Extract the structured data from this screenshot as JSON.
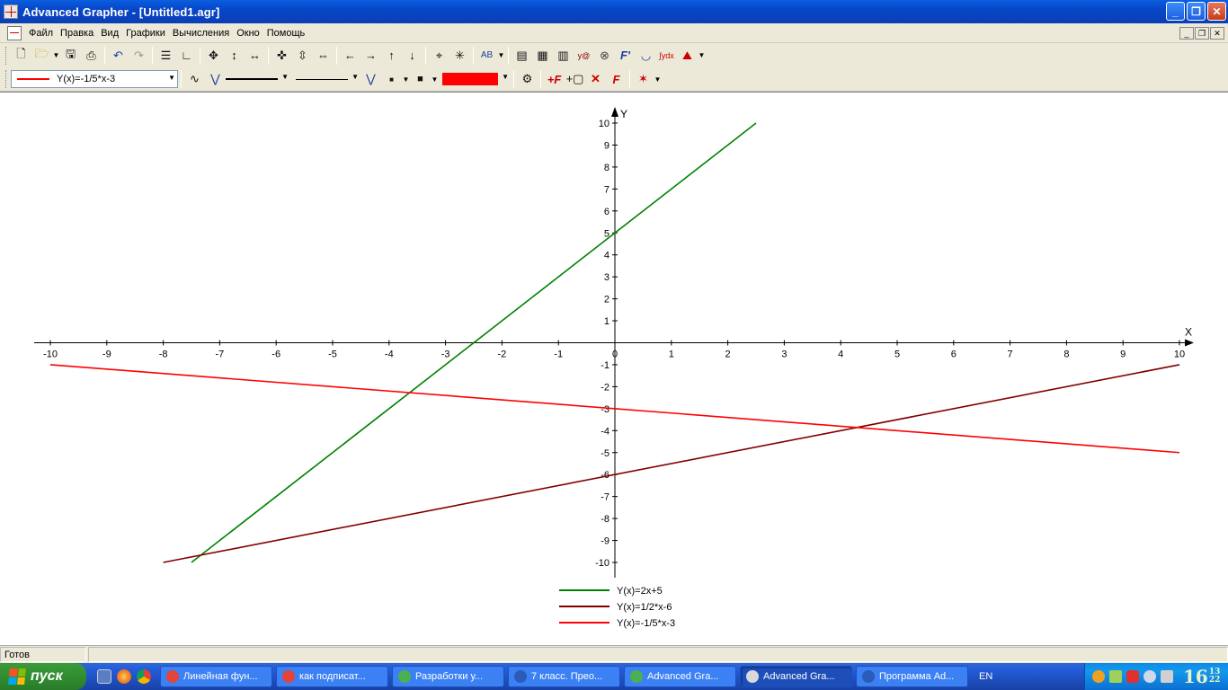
{
  "window": {
    "title": "Advanced Grapher - [Untitled1.agr]"
  },
  "menu": [
    "Файл",
    "Правка",
    "Вид",
    "Графики",
    "Вычисления",
    "Окно",
    "Помощь"
  ],
  "toolbar2": {
    "selected_graph": "Y(x)=-1/5*x-3",
    "line_color": "#ff0000"
  },
  "chart_data": {
    "type": "line",
    "xlabel": "X",
    "ylabel": "Y",
    "xlim": [
      -10,
      10
    ],
    "ylim": [
      -10,
      10
    ],
    "x_ticks": [
      "-10",
      "-9",
      "-8",
      "-7",
      "-6",
      "-5",
      "-4",
      "-3",
      "-2",
      "-1",
      "0",
      "1",
      "2",
      "3",
      "4",
      "5",
      "6",
      "7",
      "8",
      "9",
      "10"
    ],
    "y_ticks": [
      "10",
      "9",
      "8",
      "7",
      "6",
      "5",
      "4",
      "3",
      "2",
      "1",
      "-1",
      "-2",
      "-3",
      "-4",
      "-5",
      "-6",
      "-7",
      "-8",
      "-9",
      "-10"
    ],
    "series": [
      {
        "name": "Y(x)=2x+5",
        "color": "#008000",
        "x": [
          -7.5,
          2.5
        ],
        "y": [
          -10,
          10
        ]
      },
      {
        "name": "Y(x)=1/2*x-6",
        "color": "#800000",
        "x": [
          -8,
          10
        ],
        "y": [
          -10,
          -1
        ]
      },
      {
        "name": "Y(x)=-1/5*x-3",
        "color": "#ff0000",
        "x": [
          -10,
          10
        ],
        "y": [
          -1,
          -5
        ]
      }
    ],
    "legend": "bottom-center"
  },
  "status": {
    "text": "Готов"
  },
  "taskbar": {
    "start": "пуск",
    "tasks": [
      {
        "label": "Линейная фун...",
        "icon_color": "#e0443a",
        "active": false
      },
      {
        "label": "как подписат...",
        "icon_color": "#e0443a",
        "active": false
      },
      {
        "label": "Разработки у...",
        "icon_color": "#4caf50",
        "active": false
      },
      {
        "label": "7 класс. Прео...",
        "icon_color": "#2b5bb8",
        "active": false
      },
      {
        "label": "Advanced Gra...",
        "icon_color": "#4caf50",
        "active": false
      },
      {
        "label": "Advanced Gra...",
        "icon_color": "#d9d9d9",
        "active": true
      },
      {
        "label": "Программа Ad...",
        "icon_color": "#2b5bb8",
        "active": false
      }
    ],
    "lang": "EN",
    "clock": {
      "hm": "16",
      "min": "13",
      "sec": "22"
    }
  }
}
